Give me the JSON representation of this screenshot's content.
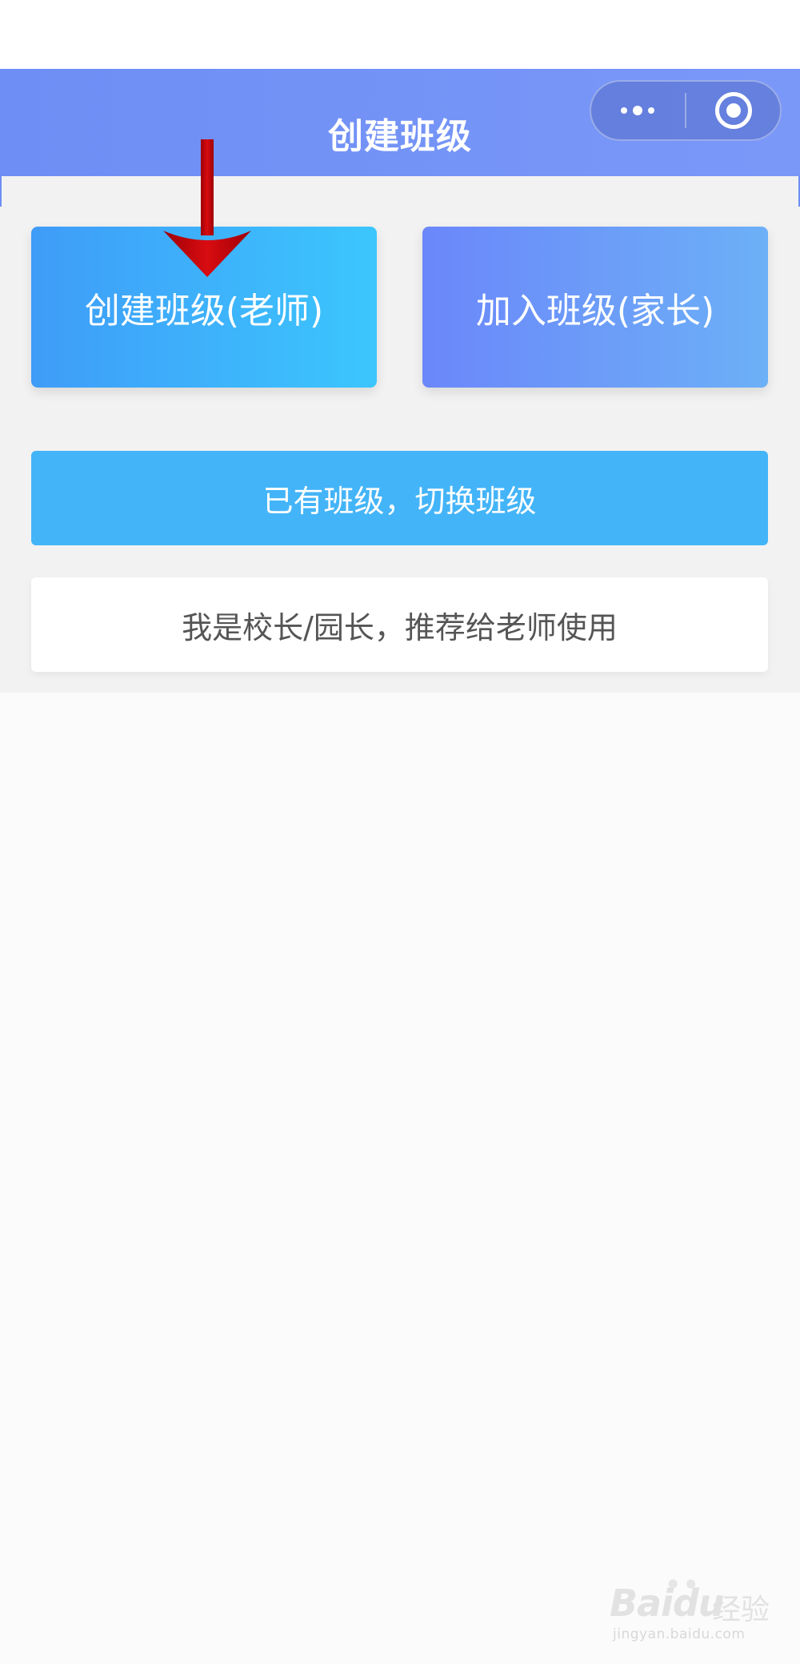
{
  "nav": {
    "title": "创建班级",
    "menu_icon": "more-dots-icon",
    "close_icon": "close-target-icon"
  },
  "cards": {
    "create_label": "创建班级(老师)",
    "join_label": "加入班级(家长)"
  },
  "actions": {
    "switch_label": "已有班级，切换班级",
    "recommend_label": "我是校长/园长，推荐给老师使用"
  },
  "annotation": {
    "arrow_icon": "red-down-arrow-icon",
    "arrow_color": "#c8080b"
  },
  "watermark": {
    "logo_text": "Baidu",
    "cn_text": "经验",
    "url_text": "jingyan.baidu.com"
  },
  "colors": {
    "nav_bg": "#6e8ef5",
    "create_gradient": [
      "#3f9cf8",
      "#3cc6fd"
    ],
    "join_gradient": [
      "#6b87fa",
      "#6cb0f7"
    ],
    "switch_bg": "#44b4f8",
    "content_bg": "#f2f2f2"
  }
}
